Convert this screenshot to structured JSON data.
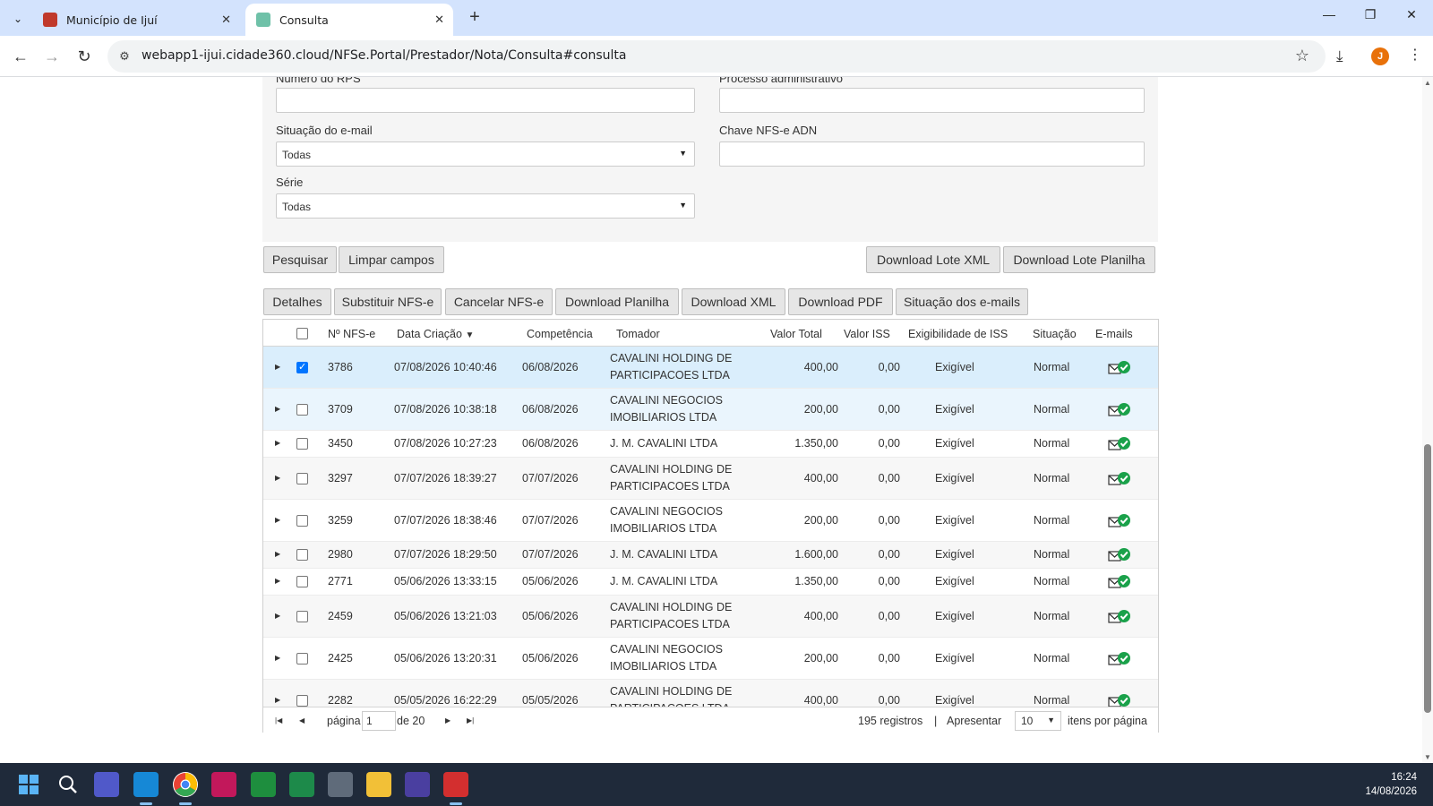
{
  "browser": {
    "tabs": [
      {
        "title": "Município de Ijuí",
        "close": "✕"
      },
      {
        "title": "Consulta",
        "close": "✕"
      }
    ],
    "new_tab": "+",
    "url": "webapp1-ijui.cidade360.cloud/NFSe.Portal/Prestador/Nota/Consulta#consulta",
    "avatar_letter": "J",
    "window_controls": {
      "minimize": "—",
      "maximize": "❐",
      "close": "✕"
    }
  },
  "filters": {
    "numero_rps_label": "Número do RPS",
    "processo_label": "Processo administrativo",
    "situacao_email_label": "Situação do e-mail",
    "situacao_email_value": "Todas",
    "chave_label": "Chave NFS-e ADN",
    "serie_label": "Série",
    "serie_value": "Todas"
  },
  "actions": {
    "pesquisar": "Pesquisar",
    "limpar": "Limpar campos",
    "download_lote_xml": "Download Lote XML",
    "download_lote_planilha": "Download Lote Planilha"
  },
  "toolbar": {
    "detalhes": "Detalhes",
    "substituir": "Substituir NFS-e",
    "cancelar": "Cancelar NFS-e",
    "download_planilha": "Download Planilha",
    "download_xml": "Download XML",
    "download_pdf": "Download PDF",
    "situacao_emails": "Situação dos e-mails"
  },
  "table": {
    "headers": {
      "numero": "Nº NFS-e",
      "data": "Data Criação",
      "sort_indicator": "▼",
      "competencia": "Competência",
      "tomador": "Tomador",
      "valor_total": "Valor Total",
      "valor_iss": "Valor ISS",
      "exigibilidade": "Exigibilidade de ISS",
      "situacao": "Situação",
      "emails": "E-mails"
    },
    "rows": [
      {
        "numero": "3786",
        "data": "07/08/2026 10:40:46",
        "competencia": "06/08/2026",
        "tomador1": "CAVALINI HOLDING DE",
        "tomador2": "PARTICIPACOES LTDA",
        "valor_total": "400,00",
        "valor_iss": "0,00",
        "exigibilidade": "Exigível",
        "situacao": "Normal",
        "checked": true
      },
      {
        "numero": "3709",
        "data": "07/08/2026 10:38:18",
        "competencia": "06/08/2026",
        "tomador1": "CAVALINI NEGOCIOS",
        "tomador2": "IMOBILIARIOS LTDA",
        "valor_total": "200,00",
        "valor_iss": "0,00",
        "exigibilidade": "Exigível",
        "situacao": "Normal",
        "checked": false
      },
      {
        "numero": "3450",
        "data": "07/08/2026 10:27:23",
        "competencia": "06/08/2026",
        "tomador1": "J. M. CAVALINI LTDA",
        "tomador2": "",
        "valor_total": "1.350,00",
        "valor_iss": "0,00",
        "exigibilidade": "Exigível",
        "situacao": "Normal",
        "checked": false
      },
      {
        "numero": "3297",
        "data": "07/07/2026 18:39:27",
        "competencia": "07/07/2026",
        "tomador1": "CAVALINI HOLDING DE",
        "tomador2": "PARTICIPACOES LTDA",
        "valor_total": "400,00",
        "valor_iss": "0,00",
        "exigibilidade": "Exigível",
        "situacao": "Normal",
        "checked": false
      },
      {
        "numero": "3259",
        "data": "07/07/2026 18:38:46",
        "competencia": "07/07/2026",
        "tomador1": "CAVALINI NEGOCIOS",
        "tomador2": "IMOBILIARIOS LTDA",
        "valor_total": "200,00",
        "valor_iss": "0,00",
        "exigibilidade": "Exigível",
        "situacao": "Normal",
        "checked": false
      },
      {
        "numero": "2980",
        "data": "07/07/2026 18:29:50",
        "competencia": "07/07/2026",
        "tomador1": "J. M. CAVALINI LTDA",
        "tomador2": "",
        "valor_total": "1.600,00",
        "valor_iss": "0,00",
        "exigibilidade": "Exigível",
        "situacao": "Normal",
        "checked": false
      },
      {
        "numero": "2771",
        "data": "05/06/2026 13:33:15",
        "competencia": "05/06/2026",
        "tomador1": "J. M. CAVALINI LTDA",
        "tomador2": "",
        "valor_total": "1.350,00",
        "valor_iss": "0,00",
        "exigibilidade": "Exigível",
        "situacao": "Normal",
        "checked": false
      },
      {
        "numero": "2459",
        "data": "05/06/2026 13:21:03",
        "competencia": "05/06/2026",
        "tomador1": "CAVALINI HOLDING DE",
        "tomador2": "PARTICIPACOES LTDA",
        "valor_total": "400,00",
        "valor_iss": "0,00",
        "exigibilidade": "Exigível",
        "situacao": "Normal",
        "checked": false
      },
      {
        "numero": "2425",
        "data": "05/06/2026 13:20:31",
        "competencia": "05/06/2026",
        "tomador1": "CAVALINI NEGOCIOS",
        "tomador2": "IMOBILIARIOS LTDA",
        "valor_total": "200,00",
        "valor_iss": "0,00",
        "exigibilidade": "Exigível",
        "situacao": "Normal",
        "checked": false
      },
      {
        "numero": "2282",
        "data": "05/05/2026 16:22:29",
        "competencia": "05/05/2026",
        "tomador1": "CAVALINI HOLDING DE",
        "tomador2": "PARTICIPACOES LTDA",
        "valor_total": "400,00",
        "valor_iss": "0,00",
        "exigibilidade": "Exigível",
        "situacao": "Normal",
        "checked": false
      }
    ]
  },
  "pager": {
    "pagina_label": "página",
    "pagina_value": "1",
    "de_label": "de 20",
    "registros": "195 registros",
    "separator": "|",
    "apresentar": "Apresentar",
    "per_page": "10",
    "itens_label": "itens por página"
  },
  "colors": {
    "selected_row": "#daeefc",
    "email_ok": "#1aa14a",
    "checkbox_blue": "#0075ff"
  },
  "taskbar": {
    "time": "16:24",
    "date": "14/08/2026",
    "icons": [
      "windows-start-icon",
      "search-icon",
      "teams-icon",
      "edge-icon",
      "chrome-icon",
      "notes-icon",
      "sheets-icon",
      "app-icon",
      "calculator-icon",
      "file-explorer-icon",
      "app2-icon",
      "acrobat-icon"
    ]
  }
}
